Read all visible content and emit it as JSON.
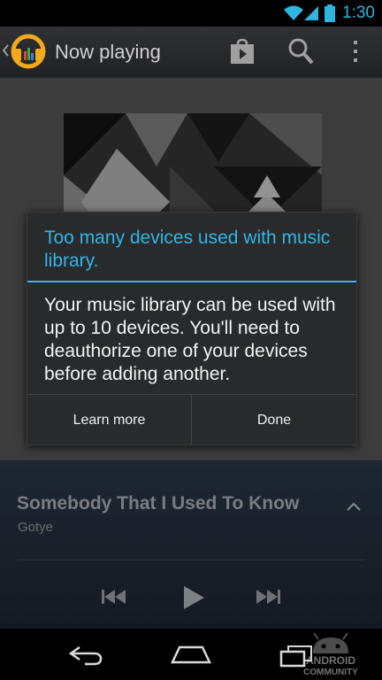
{
  "status_bar": {
    "time": "1:30"
  },
  "action_bar": {
    "title": "Now playing"
  },
  "dialog": {
    "title": "Too many devices used with music library.",
    "message": "Your music library can be used with up to 10 devices. You'll need to deauthorize one of your devices before adding another.",
    "buttons": {
      "learn_more": "Learn more",
      "done": "Done"
    }
  },
  "now_playing": {
    "song": "Somebody That I Used To Know",
    "artist": "Gotye"
  },
  "watermark": "ANDROID COMMUNITY",
  "colors": {
    "accent": "#33b5e5",
    "dialog_bg": "#282a2c",
    "action_bar": "#2b2c2f"
  }
}
